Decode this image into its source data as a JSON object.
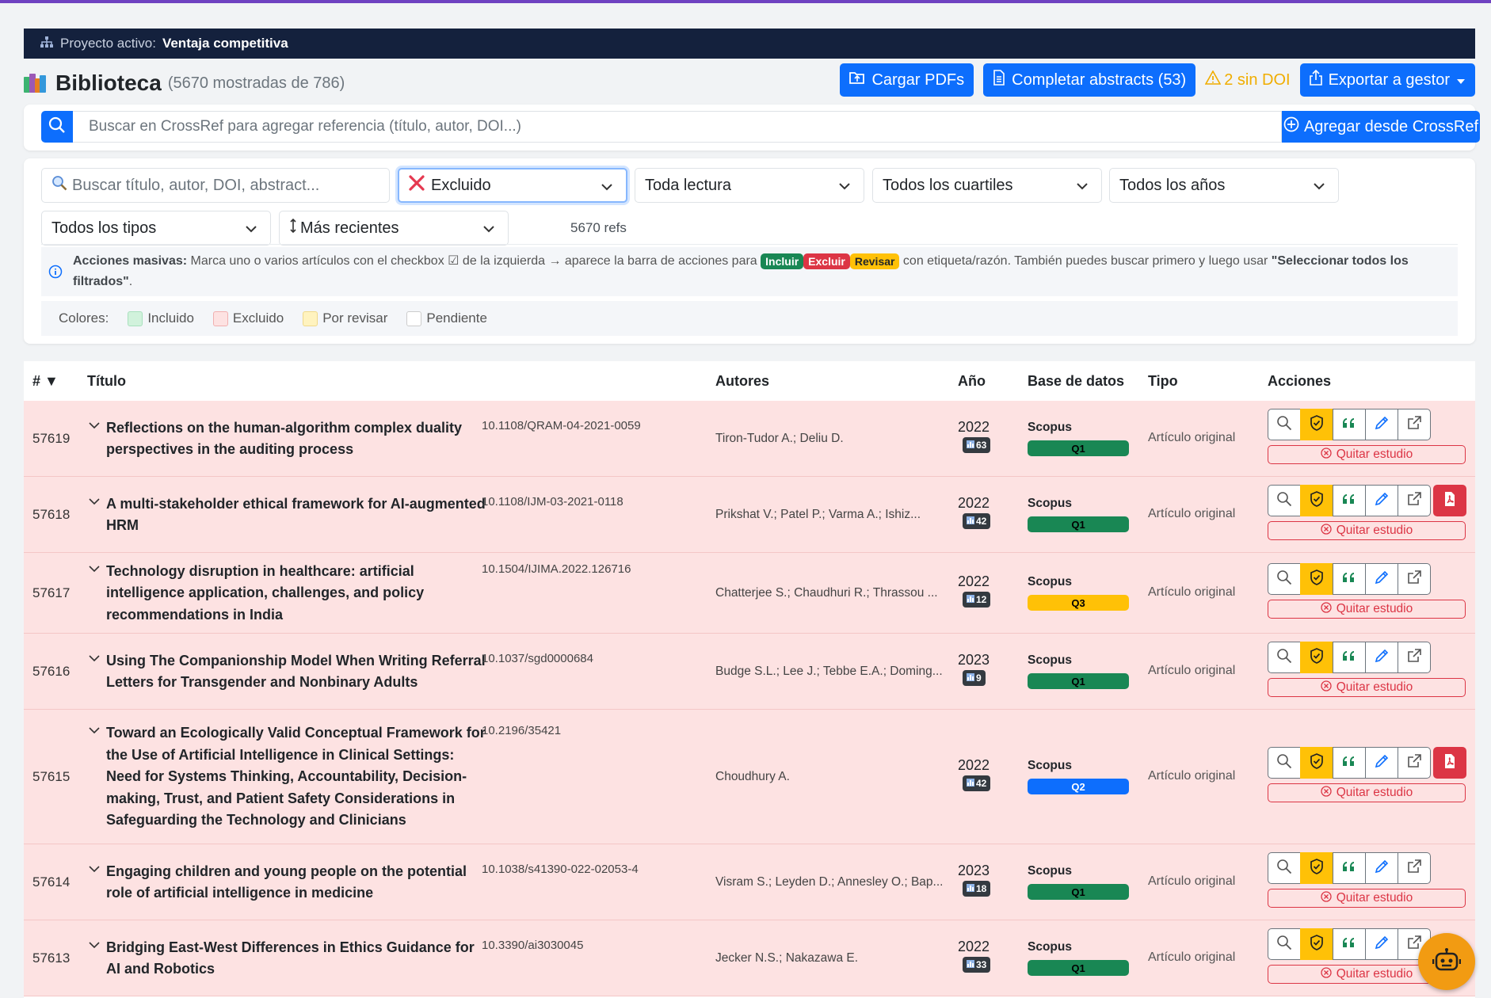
{
  "project": {
    "label": "Proyecto activo:",
    "name": "Ventaja competitiva"
  },
  "header": {
    "title": "Biblioteca",
    "count": "(5670 mostradas de 786)"
  },
  "toolbar": {
    "upload": "Cargar PDFs",
    "complete": "Completar abstracts (53)",
    "no_doi": "2 sin DOI",
    "export": "Exportar a gestor"
  },
  "crossref": {
    "placeholder": "Buscar en CrossRef para agregar referencia (título, autor, DOI...)",
    "add": "Agregar desde CrossRef"
  },
  "filters": {
    "search_placeholder": "Buscar título, autor, DOI, abstract...",
    "status": "Excluido",
    "reading": "Toda lectura",
    "quartile": "Todos los cuartiles",
    "years": "Todos los años",
    "types": "Todos los tipos",
    "sort": "Más recientes",
    "refs": "5670 refs"
  },
  "bulk": {
    "label": "Acciones masivas:",
    "text1": "Marca uno o varios artículos con el checkbox ☑ de la izquierda → aparece la barra de acciones para",
    "tag_include": "Incluir",
    "tag_exclude": "Excluir",
    "tag_review": "Revisar",
    "text2": "con etiqueta/razón. También puedes buscar primero y luego usar",
    "select_all": "\"Seleccionar todos los filtrados\"",
    "end": "."
  },
  "legend": {
    "label": "Colores:",
    "items": [
      "Incluido",
      "Excluido",
      "Por revisar",
      "Pendiente"
    ],
    "colors": [
      "#d1f2dc",
      "#fde2e2",
      "#fff3bf",
      "#ffffff"
    ]
  },
  "table": {
    "headers": {
      "num": "#",
      "title": "Título",
      "authors": "Autores",
      "year": "Año",
      "db": "Base de datos",
      "type": "Tipo",
      "actions": "Acciones"
    },
    "remove_label": "Quitar estudio",
    "rows": [
      {
        "id": "57619",
        "title": "Reflections on the human-algorithm complex duality perspectives in the auditing process",
        "doi": "10.1108/QRAM-04-2021-0059",
        "authors": "Tiron-Tudor A.; Deliu D.",
        "year": "2022",
        "cites": "63",
        "db": "Scopus",
        "quartile": "Q1",
        "qcolor": "#198754",
        "type": "Artículo original",
        "pdf": false
      },
      {
        "id": "57618",
        "title": "A multi-stakeholder ethical framework for AI-augmented HRM",
        "doi": "10.1108/IJM-03-2021-0118",
        "authors": "Prikshat V.; Patel P.; Varma A.; Ishiz...",
        "year": "2022",
        "cites": "42",
        "db": "Scopus",
        "quartile": "Q1",
        "qcolor": "#198754",
        "type": "Artículo original",
        "pdf": true
      },
      {
        "id": "57617",
        "title": "Technology disruption in healthcare: artificial intelligence application, challenges, and policy recommendations in India",
        "doi": "10.1504/IJIMA.2022.126716",
        "authors": "Chatterjee S.; Chaudhuri R.; Thrassou ...",
        "year": "2022",
        "cites": "12",
        "db": "Scopus",
        "quartile": "Q3",
        "qcolor": "#ffc107",
        "type": "Artículo original",
        "pdf": false
      },
      {
        "id": "57616",
        "title": "Using The Companionship Model When Writing Referral Letters for Transgender and Nonbinary Adults",
        "doi": "10.1037/sgd0000684",
        "authors": "Budge S.L.; Lee J.; Tebbe E.A.; Doming...",
        "year": "2023",
        "cites": "9",
        "db": "Scopus",
        "quartile": "Q1",
        "qcolor": "#198754",
        "type": "Artículo original",
        "pdf": false
      },
      {
        "id": "57615",
        "title": "Toward an Ecologically Valid Conceptual Framework for the Use of Artificial Intelligence in Clinical Settings: Need for Systems Thinking, Accountability, Decision-making, Trust, and Patient Safety Considerations in Safeguarding the Technology and Clinicians",
        "doi": "10.2196/35421",
        "authors": "Choudhury A.",
        "year": "2022",
        "cites": "42",
        "db": "Scopus",
        "quartile": "Q2",
        "qcolor": "#0d6efd",
        "type": "Artículo original",
        "pdf": true
      },
      {
        "id": "57614",
        "title": "Engaging children and young people on the potential role of artificial intelligence in medicine",
        "doi": "10.1038/s41390-022-02053-4",
        "authors": "Visram S.; Leyden D.; Annesley O.; Bap...",
        "year": "2023",
        "cites": "18",
        "db": "Scopus",
        "quartile": "Q1",
        "qcolor": "#198754",
        "type": "Artículo original",
        "pdf": false
      },
      {
        "id": "57613",
        "title": "Bridging East-West Differences in Ethics Guidance for AI and Robotics",
        "doi": "10.3390/ai3030045",
        "authors": "Jecker N.S.; Nakazawa E.",
        "year": "2022",
        "cites": "33",
        "db": "Scopus",
        "quartile": "Q1",
        "qcolor": "#198754",
        "type": "Artículo original",
        "pdf": false
      }
    ]
  },
  "colors": {
    "accent": "#0d6efd",
    "excluded_row": "#fde2e2",
    "nav": "#14213d",
    "warning": "#ffc107",
    "danger": "#dc3545"
  }
}
